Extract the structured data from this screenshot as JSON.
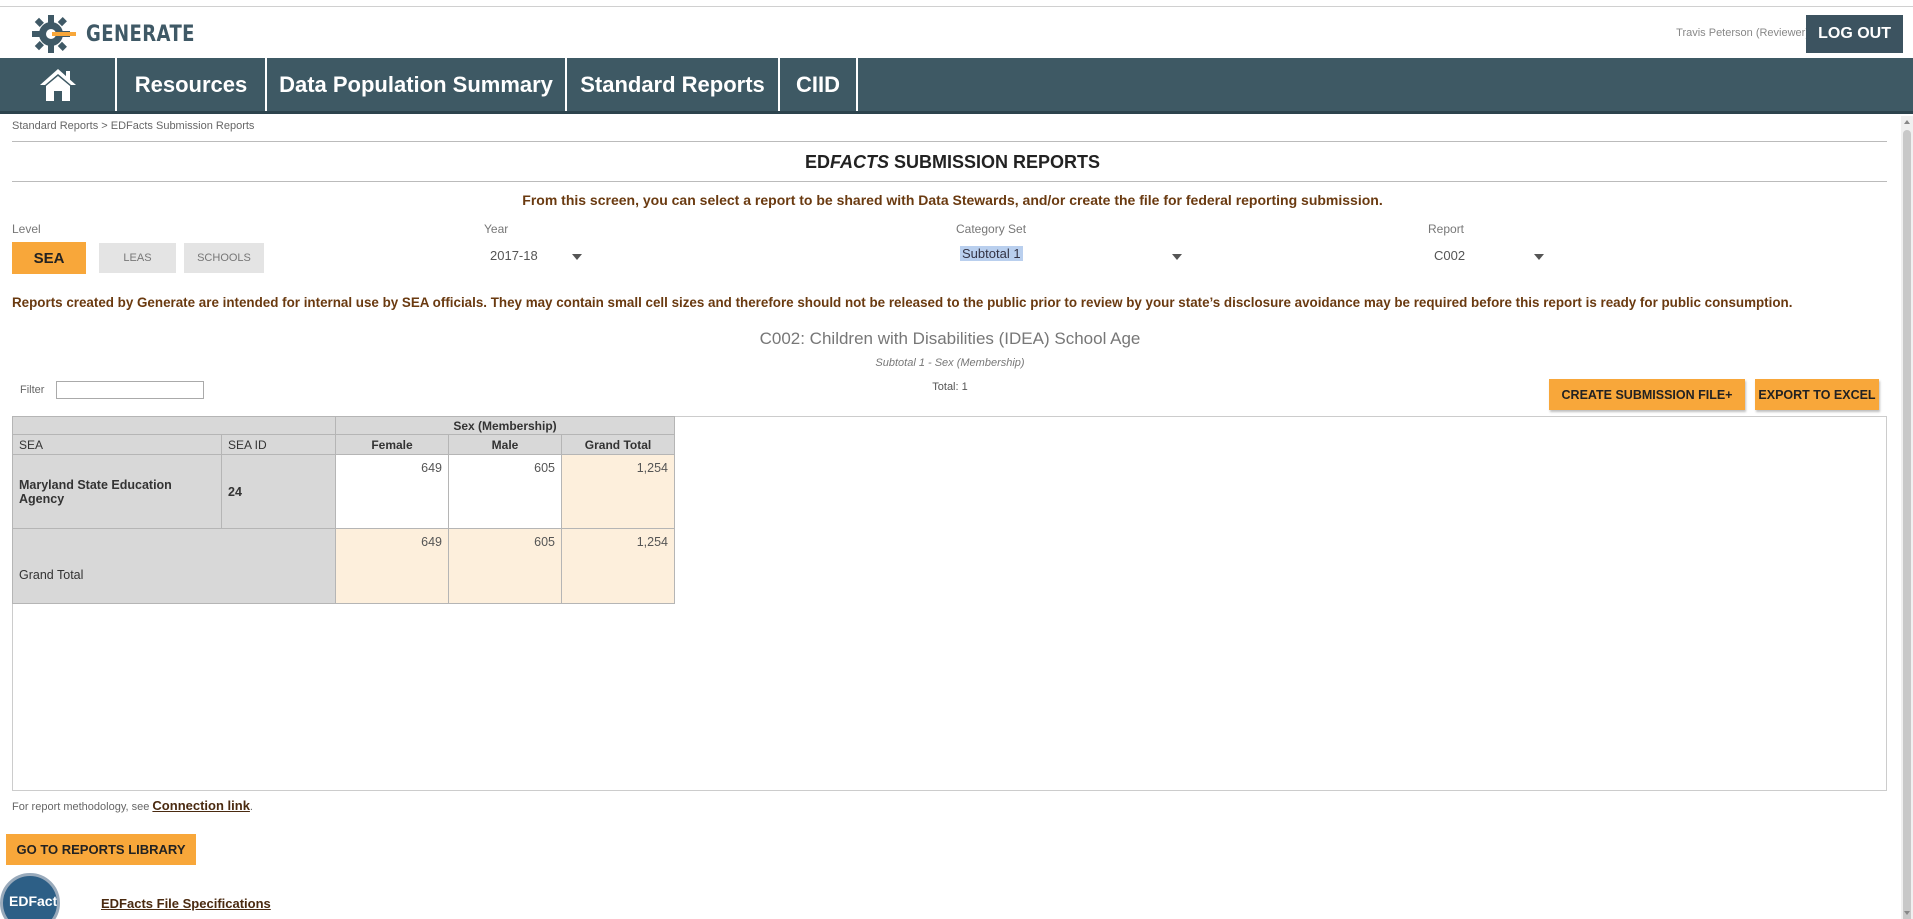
{
  "header": {
    "brand": "GENERATE",
    "user": "Travis Peterson (Reviewer)",
    "logout_label": "LOG OUT"
  },
  "nav": {
    "items": [
      {
        "label": "Resources"
      },
      {
        "label": "Data Population Summary"
      },
      {
        "label": "Standard Reports"
      },
      {
        "label": "CIID"
      }
    ]
  },
  "breadcrumb": "Standard Reports > EDFacts Submission Reports",
  "page_title": {
    "prefix": "ED",
    "italic": "FACTS",
    "suffix": " SUBMISSION REPORTS"
  },
  "instructions": "From this screen, you can select a report to be shared with Data Stewards, and/or create the file for federal reporting submission.",
  "filters": {
    "level_label": "Level",
    "levels": [
      "SEA",
      "LEAS",
      "SCHOOLS"
    ],
    "selected_level": "SEA",
    "year_label": "Year",
    "year_value": "2017-18",
    "category_label": "Category Set",
    "category_value": "Subtotal 1",
    "report_label": "Report",
    "report_value": "C002"
  },
  "disclaimer": "Reports created by Generate are intended for internal use by SEA officials. They may contain small cell sizes and therefore should not be released to the public prior to review by your state’s disclosure avoidance may be required before this report is ready for public consumption.",
  "report": {
    "title": "C002: Children with Disabilities (IDEA) School Age",
    "subtitle": "Subtotal 1 - Sex (Membership)",
    "total": "Total: 1",
    "filter_label": "Filter",
    "filter_value": ""
  },
  "actions": {
    "create": "CREATE SUBMISSION FILE+",
    "export": "EXPORT TO EXCEL"
  },
  "table": {
    "group_header": "Sex (Membership)",
    "columns": [
      "SEA",
      "SEA ID",
      "Female",
      "Male",
      "Grand Total"
    ],
    "rows": [
      {
        "sea": "Maryland State Education Agency",
        "sea_id": "24",
        "female": "649",
        "male": "605",
        "total": "1,254"
      }
    ],
    "grand_total": {
      "label": "Grand Total",
      "female": "649",
      "male": "605",
      "total": "1,254"
    }
  },
  "footer": {
    "method_text": "For report methodology, see ",
    "method_link": "Connection link",
    "method_period": ".",
    "library_button": "GO TO REPORTS LIBRARY",
    "logo_text": "EDFacts",
    "specs_link": "EDFacts File Specifications"
  },
  "colors": {
    "nav_bg": "#3e5964",
    "accent_orange": "#f8a73a",
    "text_brown": "#6a3a10"
  }
}
